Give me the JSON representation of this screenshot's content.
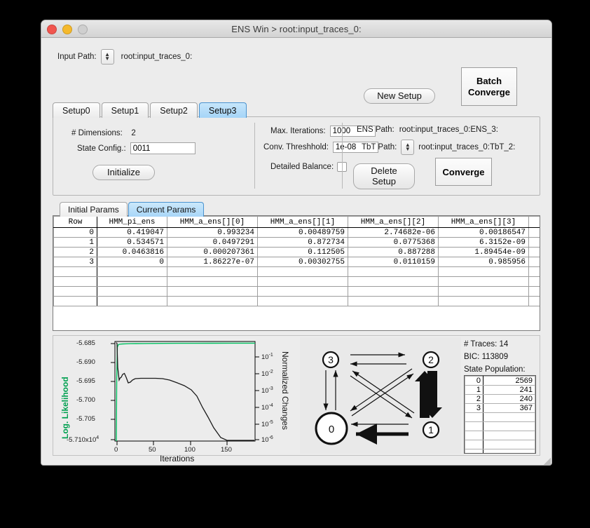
{
  "window": {
    "title": "ENS Win > root:input_traces_0:",
    "lights": [
      "close",
      "minimize",
      "zoom"
    ]
  },
  "toolbar": {
    "input_path_label": "Input Path:",
    "input_path_value": "root:input_traces_0:",
    "new_setup_label": "New Setup",
    "batch_converge_line1": "Batch",
    "batch_converge_line2": "Converge"
  },
  "setup_tabs": [
    {
      "label": "Setup0",
      "active": false
    },
    {
      "label": "Setup1",
      "active": false
    },
    {
      "label": "Setup2",
      "active": false
    },
    {
      "label": "Setup3",
      "active": true
    }
  ],
  "settings": {
    "dimensions_label": "# Dimensions:",
    "dimensions_value": "2",
    "state_config_label": "State Config.:",
    "state_config_value": "0011",
    "initialize_label": "Initialize",
    "max_iterations_label": "Max. Iterations:",
    "max_iterations_value": "1000",
    "conv_threshold_label": "Conv. Threshhold:",
    "conv_threshold_value": "1e-08",
    "detailed_balance_label": "Detailed Balance:",
    "detailed_balance_checked": false,
    "ens_path_label": "ENS Path:",
    "ens_path_value": "root:input_traces_0:ENS_3:",
    "tbt_path_label": "TbT Path:",
    "tbt_path_value": "root:input_traces_0:TbT_2:",
    "delete_setup_label": "Delete Setup",
    "converge_label": "Converge"
  },
  "params_tabs": [
    {
      "label": "Initial Params",
      "active": false
    },
    {
      "label": "Current Params",
      "active": true
    }
  ],
  "params_table": {
    "columns": [
      "Row",
      "HMM_pi_ens",
      "HMM_a_ens[][0]",
      "HMM_a_ens[][1]",
      "HMM_a_ens[][2]",
      "HMM_a_ens[][3]",
      ""
    ],
    "rows": [
      [
        "0",
        "0.419047",
        "0.993234",
        "0.00489759",
        "2.74682e-06",
        "0.00186547",
        ""
      ],
      [
        "1",
        "0.534571",
        "0.0497291",
        "0.872734",
        "0.0775368",
        "6.3152e-09",
        ""
      ],
      [
        "2",
        "0.0463816",
        "0.000207361",
        "0.112505",
        "0.887288",
        "1.89454e-09",
        ""
      ],
      [
        "3",
        "0",
        "1.86227e-07",
        "0.00302755",
        "0.0110159",
        "0.985956",
        ""
      ],
      [
        "",
        "",
        "",
        "",
        "",
        "",
        ""
      ],
      [
        "",
        "",
        "",
        "",
        "",
        "",
        ""
      ],
      [
        "",
        "",
        "",
        "",
        "",
        "",
        ""
      ],
      [
        "",
        "",
        "",
        "",
        "",
        "",
        ""
      ]
    ]
  },
  "info": {
    "traces_label": "# Traces:",
    "traces_value": "14",
    "bic_label": "BIC:",
    "bic_value": "113809",
    "state_population_label": "State Population:",
    "state_population": [
      {
        "index": "0",
        "count": "2569"
      },
      {
        "index": "1",
        "count": "241"
      },
      {
        "index": "2",
        "count": "240"
      },
      {
        "index": "3",
        "count": "367"
      }
    ],
    "state_population_empty_rows": 5
  },
  "state_diagram": {
    "states": [
      "0",
      "1",
      "2",
      "3"
    ],
    "highlighted_state": "0"
  },
  "chart_data": {
    "type": "line",
    "title": "",
    "xlabel": "Iterations",
    "ylabel_left": "Log. Likelihood",
    "ylabel_right": "Normalized Changes",
    "left_axis_color": "#00a050",
    "xticks": [
      0,
      50,
      100,
      150
    ],
    "xlim": [
      0,
      190
    ],
    "left_yticks": [
      "-5.685",
      "-5.690",
      "-5.695",
      "-5.700",
      "-5.705",
      "-5.710x10"
    ],
    "left_y_exponent": "4",
    "left_ylim": [
      -5.7105,
      -5.6835
    ],
    "right_yticks": [
      "-1",
      "-2",
      "-3",
      "-4",
      "-5",
      "-6"
    ],
    "right_ytick_base": "10",
    "right_ylim_log": [
      -6.25,
      -0.4
    ],
    "grid": false,
    "legend": "none",
    "series": [
      {
        "name": "Log. Likelihood",
        "color": "#00c060",
        "axis": "left",
        "x": [
          0,
          0.5,
          1,
          2,
          3,
          5,
          8,
          12,
          18,
          25,
          35,
          50,
          70,
          95,
          120,
          150,
          175,
          190
        ],
        "y": [
          -5.7105,
          -5.696,
          -5.6862,
          -5.68495,
          -5.68465,
          -5.6845,
          -5.6844,
          -5.68433,
          -5.68428,
          -5.68424,
          -5.6842,
          -5.68417,
          -5.68414,
          -5.68412,
          -5.68411,
          -5.6841,
          -5.6841,
          -5.6841
        ]
      },
      {
        "name": "Normalized Changes",
        "color": "#1a1a1a",
        "axis": "right",
        "x": [
          0,
          1,
          2,
          4,
          6,
          8,
          11,
          14,
          17,
          20,
          23,
          26,
          30,
          38,
          48,
          58,
          68,
          78,
          88,
          98,
          108,
          116,
          124,
          132,
          140,
          150,
          160,
          170,
          180,
          188
        ],
        "y_log": [
          -0.45,
          -0.5,
          -1.35,
          -1.82,
          -1.75,
          -1.72,
          -1.62,
          -1.58,
          -1.72,
          -1.93,
          -1.9,
          -1.82,
          -1.78,
          -1.76,
          -1.76,
          -1.76,
          -1.77,
          -1.83,
          -1.93,
          -2.05,
          -2.2,
          -2.45,
          -2.9,
          -3.3,
          -3.7,
          -4.15,
          -4.6,
          -5.1,
          -5.6,
          -6.0
        ]
      }
    ]
  }
}
